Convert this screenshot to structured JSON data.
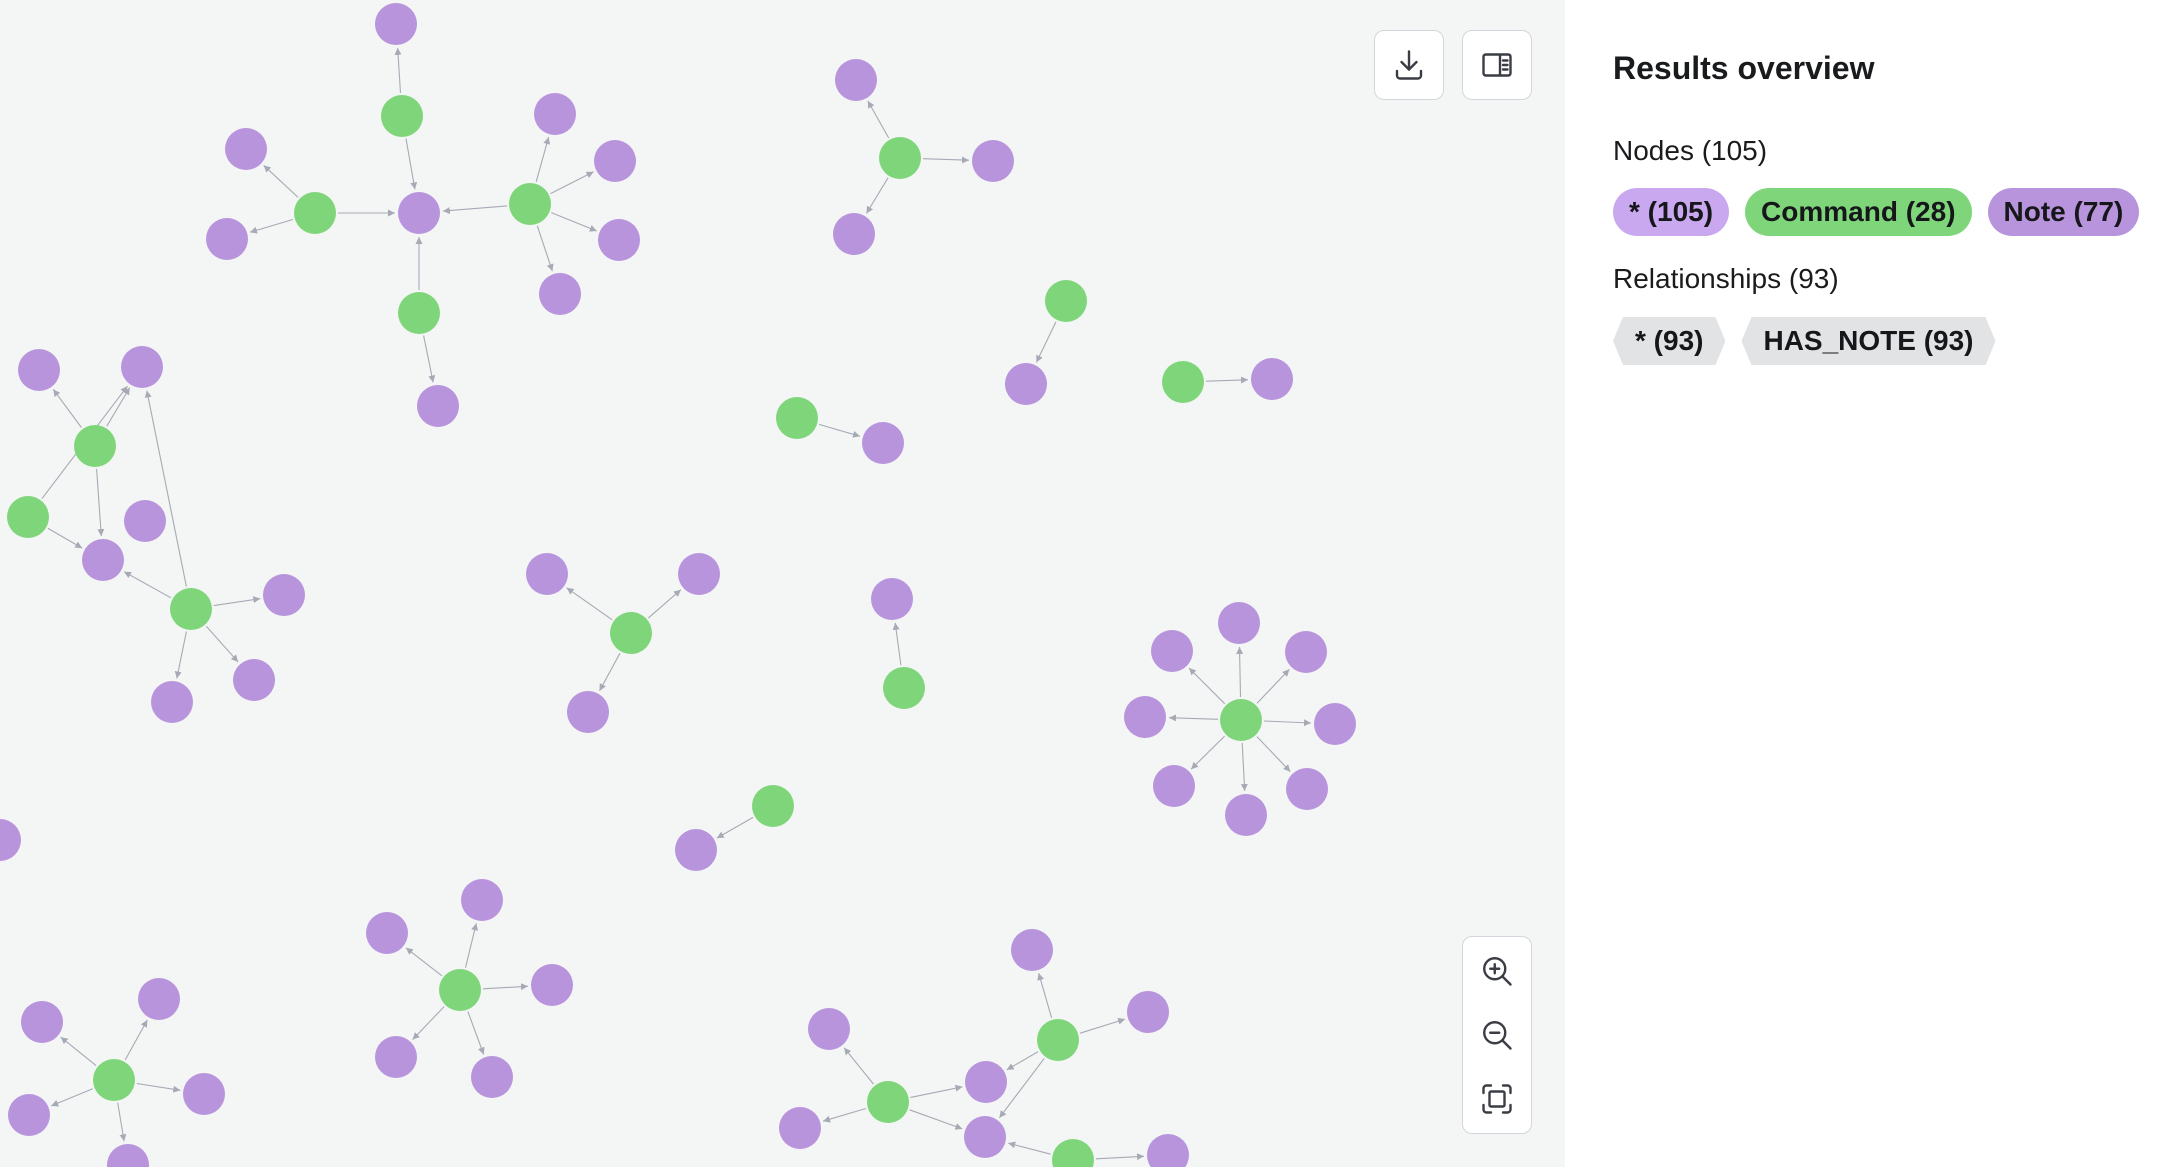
{
  "toolbar": {
    "download_icon": "download-icon",
    "sidebar_toggle_icon": "sidebar-toggle-icon"
  },
  "zoom": {
    "zoom_in_icon": "zoom-in-icon",
    "zoom_out_icon": "zoom-out-icon",
    "fit_icon": "fit-to-screen-icon"
  },
  "panel": {
    "title": "Results overview",
    "nodes_label": "Nodes (105)",
    "node_chips": [
      {
        "label": "* (105)",
        "kind": "all"
      },
      {
        "label": "Command (28)",
        "kind": "command"
      },
      {
        "label": "Note (77)",
        "kind": "note"
      }
    ],
    "relationships_label": "Relationships (93)",
    "relationship_chips": [
      {
        "label": "* (93)"
      },
      {
        "label": "HAS_NOTE (93)"
      }
    ]
  },
  "colors": {
    "command": "#7fd67a",
    "note": "#b894dc",
    "all_nodes": "#c9a8f0",
    "canvas_background": "#f4f5f5"
  }
}
